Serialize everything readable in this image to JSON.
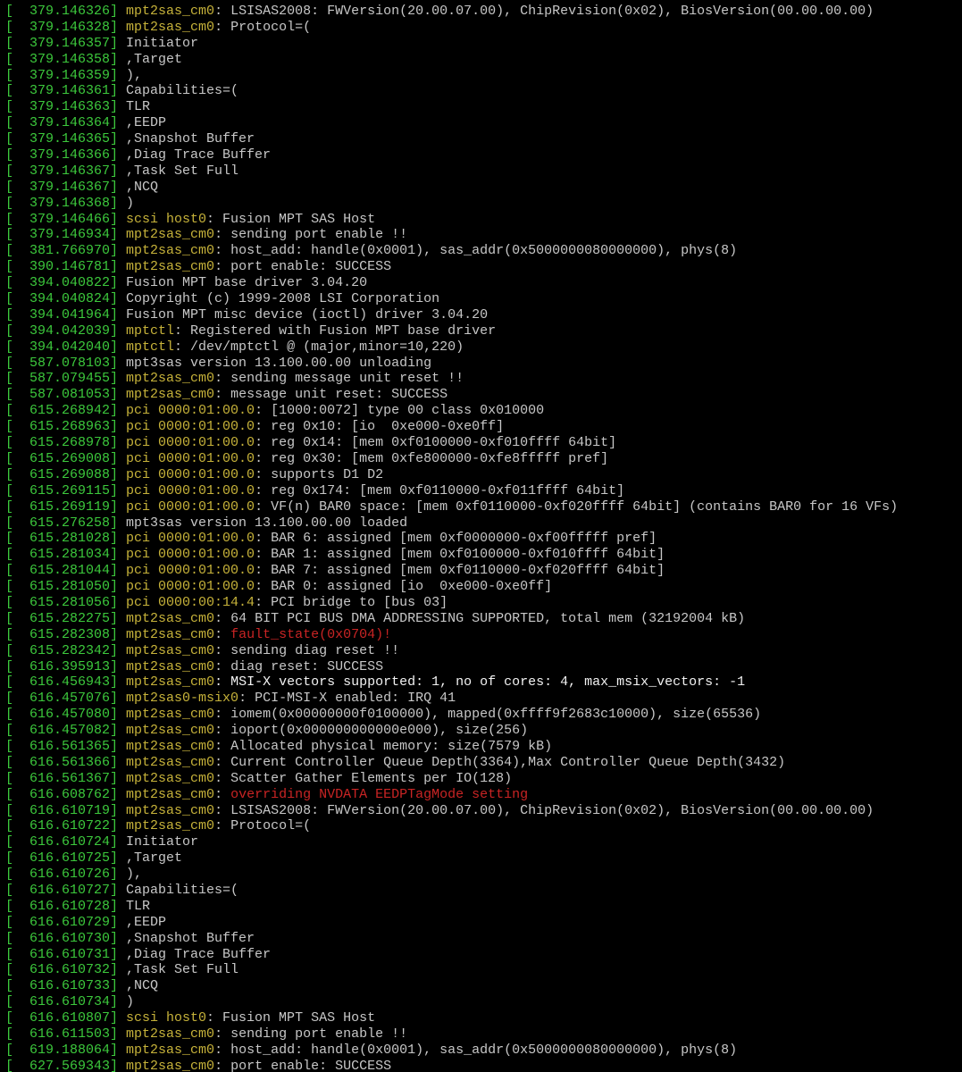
{
  "colors": {
    "background": "#000000",
    "timestamp": "#3cc83c",
    "source": "#c6b23a",
    "text": "#c7c7c7",
    "bright": "#f2f2f2",
    "error": "#c92424"
  },
  "lines": [
    {
      "ts": "[  379.146326] ",
      "src": "mpt2sas_cm0",
      "msg": ": LSISAS2008: FWVersion(20.00.07.00), ChipRevision(0x02), BiosVersion(00.00.00.00)"
    },
    {
      "ts": "[  379.146328] ",
      "src": "mpt2sas_cm0",
      "msg": ": Protocol=("
    },
    {
      "ts": "[  379.146357] ",
      "src": "",
      "msg": "Initiator"
    },
    {
      "ts": "[  379.146358] ",
      "src": "",
      "msg": ",Target"
    },
    {
      "ts": "[  379.146359] ",
      "src": "",
      "msg": "),"
    },
    {
      "ts": "[  379.146361] ",
      "src": "",
      "msg": "Capabilities=("
    },
    {
      "ts": "[  379.146363] ",
      "src": "",
      "msg": "TLR"
    },
    {
      "ts": "[  379.146364] ",
      "src": "",
      "msg": ",EEDP"
    },
    {
      "ts": "[  379.146365] ",
      "src": "",
      "msg": ",Snapshot Buffer"
    },
    {
      "ts": "[  379.146366] ",
      "src": "",
      "msg": ",Diag Trace Buffer"
    },
    {
      "ts": "[  379.146367] ",
      "src": "",
      "msg": ",Task Set Full"
    },
    {
      "ts": "[  379.146367] ",
      "src": "",
      "msg": ",NCQ"
    },
    {
      "ts": "[  379.146368] ",
      "src": "",
      "msg": ")"
    },
    {
      "ts": "[  379.146466] ",
      "src": "scsi host0",
      "msg": ": Fusion MPT SAS Host"
    },
    {
      "ts": "[  379.146934] ",
      "src": "mpt2sas_cm0",
      "msg": ": sending port enable !!"
    },
    {
      "ts": "[  381.766970] ",
      "src": "mpt2sas_cm0",
      "msg": ": host_add: handle(0x0001), sas_addr(0x5000000080000000), phys(8)"
    },
    {
      "ts": "[  390.146781] ",
      "src": "mpt2sas_cm0",
      "msg": ": port enable: SUCCESS"
    },
    {
      "ts": "[  394.040822] ",
      "src": "",
      "msg": "Fusion MPT base driver 3.04.20"
    },
    {
      "ts": "[  394.040824] ",
      "src": "",
      "msg": "Copyright (c) 1999-2008 LSI Corporation"
    },
    {
      "ts": "[  394.041964] ",
      "src": "",
      "msg": "Fusion MPT misc device (ioctl) driver 3.04.20"
    },
    {
      "ts": "[  394.042039] ",
      "src": "mptctl",
      "msg": ": Registered with Fusion MPT base driver"
    },
    {
      "ts": "[  394.042040] ",
      "src": "mptctl",
      "msg": ": /dev/mptctl @ (major,minor=10,220)"
    },
    {
      "ts": "[  587.078103] ",
      "src": "",
      "msg": "mpt3sas version 13.100.00.00 unloading"
    },
    {
      "ts": "[  587.079455] ",
      "src": "mpt2sas_cm0",
      "msg": ": sending message unit reset !!"
    },
    {
      "ts": "[  587.081053] ",
      "src": "mpt2sas_cm0",
      "msg": ": message unit reset: SUCCESS"
    },
    {
      "ts": "[  615.268942] ",
      "src": "pci 0000:01:00.0",
      "msg": ": [1000:0072] type 00 class 0x010000"
    },
    {
      "ts": "[  615.268963] ",
      "src": "pci 0000:01:00.0",
      "msg": ": reg 0x10: [io  0xe000-0xe0ff]"
    },
    {
      "ts": "[  615.268978] ",
      "src": "pci 0000:01:00.0",
      "msg": ": reg 0x14: [mem 0xf0100000-0xf010ffff 64bit]"
    },
    {
      "ts": "[  615.269008] ",
      "src": "pci 0000:01:00.0",
      "msg": ": reg 0x30: [mem 0xfe800000-0xfe8fffff pref]"
    },
    {
      "ts": "[  615.269088] ",
      "src": "pci 0000:01:00.0",
      "msg": ": supports D1 D2"
    },
    {
      "ts": "[  615.269115] ",
      "src": "pci 0000:01:00.0",
      "msg": ": reg 0x174: [mem 0xf0110000-0xf011ffff 64bit]"
    },
    {
      "ts": "[  615.269119] ",
      "src": "pci 0000:01:00.0",
      "msg": ": VF(n) BAR0 space: [mem 0xf0110000-0xf020ffff 64bit] (contains BAR0 for 16 VFs)"
    },
    {
      "ts": "[  615.276258] ",
      "src": "",
      "msg": "mpt3sas version 13.100.00.00 loaded"
    },
    {
      "ts": "[  615.281028] ",
      "src": "pci 0000:01:00.0",
      "msg": ": BAR 6: assigned [mem 0xf0000000-0xf00fffff pref]"
    },
    {
      "ts": "[  615.281034] ",
      "src": "pci 0000:01:00.0",
      "msg": ": BAR 1: assigned [mem 0xf0100000-0xf010ffff 64bit]"
    },
    {
      "ts": "[  615.281044] ",
      "src": "pci 0000:01:00.0",
      "msg": ": BAR 7: assigned [mem 0xf0110000-0xf020ffff 64bit]"
    },
    {
      "ts": "[  615.281050] ",
      "src": "pci 0000:01:00.0",
      "msg": ": BAR 0: assigned [io  0xe000-0xe0ff]"
    },
    {
      "ts": "[  615.281056] ",
      "src": "pci 0000:00:14.4",
      "msg": ": PCI bridge to [bus 03]"
    },
    {
      "ts": "[  615.282275] ",
      "src": "mpt2sas_cm0",
      "msg": ": 64 BIT PCI BUS DMA ADDRESSING SUPPORTED, total mem (32192004 kB)"
    },
    {
      "ts": "[  615.282308] ",
      "src": "mpt2sas_cm0",
      "msg": ": ",
      "extra": "fault_state(0x0704)!",
      "extra_style": "red"
    },
    {
      "ts": "[  615.282342] ",
      "src": "mpt2sas_cm0",
      "msg": ": sending diag reset !!"
    },
    {
      "ts": "[  616.395913] ",
      "src": "mpt2sas_cm0",
      "msg": ": diag reset: SUCCESS"
    },
    {
      "ts": "[  616.456943] ",
      "src": "mpt2sas_cm0",
      "msg": ": MSI-X vectors supported: 1, no of cores: 4, max_msix_vectors: -1",
      "style": "white"
    },
    {
      "ts": "[  616.457076] ",
      "src": "mpt2sas0-msix0",
      "msg": ": PCI-MSI-X enabled: IRQ 41"
    },
    {
      "ts": "[  616.457080] ",
      "src": "mpt2sas_cm0",
      "msg": ": iomem(0x00000000f0100000), mapped(0xffff9f2683c10000), size(65536)"
    },
    {
      "ts": "[  616.457082] ",
      "src": "mpt2sas_cm0",
      "msg": ": ioport(0x000000000000e000), size(256)"
    },
    {
      "ts": "[  616.561365] ",
      "src": "mpt2sas_cm0",
      "msg": ": Allocated physical memory: size(7579 kB)"
    },
    {
      "ts": "[  616.561366] ",
      "src": "mpt2sas_cm0",
      "msg": ": Current Controller Queue Depth(3364),Max Controller Queue Depth(3432)"
    },
    {
      "ts": "[  616.561367] ",
      "src": "mpt2sas_cm0",
      "msg": ": Scatter Gather Elements per IO(128)"
    },
    {
      "ts": "[  616.608762] ",
      "src": "mpt2sas_cm0",
      "msg": ": ",
      "extra": "overriding NVDATA EEDPTagMode setting",
      "extra_style": "red"
    },
    {
      "ts": "[  616.610719] ",
      "src": "mpt2sas_cm0",
      "msg": ": LSISAS2008: FWVersion(20.00.07.00), ChipRevision(0x02), BiosVersion(00.00.00.00)"
    },
    {
      "ts": "[  616.610722] ",
      "src": "mpt2sas_cm0",
      "msg": ": Protocol=("
    },
    {
      "ts": "[  616.610724] ",
      "src": "",
      "msg": "Initiator"
    },
    {
      "ts": "[  616.610725] ",
      "src": "",
      "msg": ",Target"
    },
    {
      "ts": "[  616.610726] ",
      "src": "",
      "msg": "),"
    },
    {
      "ts": "[  616.610727] ",
      "src": "",
      "msg": "Capabilities=("
    },
    {
      "ts": "[  616.610728] ",
      "src": "",
      "msg": "TLR"
    },
    {
      "ts": "[  616.610729] ",
      "src": "",
      "msg": ",EEDP"
    },
    {
      "ts": "[  616.610730] ",
      "src": "",
      "msg": ",Snapshot Buffer"
    },
    {
      "ts": "[  616.610731] ",
      "src": "",
      "msg": ",Diag Trace Buffer"
    },
    {
      "ts": "[  616.610732] ",
      "src": "",
      "msg": ",Task Set Full"
    },
    {
      "ts": "[  616.610733] ",
      "src": "",
      "msg": ",NCQ"
    },
    {
      "ts": "[  616.610734] ",
      "src": "",
      "msg": ")"
    },
    {
      "ts": "[  616.610807] ",
      "src": "scsi host0",
      "msg": ": Fusion MPT SAS Host"
    },
    {
      "ts": "[  616.611503] ",
      "src": "mpt2sas_cm0",
      "msg": ": sending port enable !!"
    },
    {
      "ts": "[  619.188064] ",
      "src": "mpt2sas_cm0",
      "msg": ": host_add: handle(0x0001), sas_addr(0x5000000080000000), phys(8)"
    },
    {
      "ts": "[  627.569343] ",
      "src": "mpt2sas_cm0",
      "msg": ": port enable: SUCCESS"
    }
  ]
}
